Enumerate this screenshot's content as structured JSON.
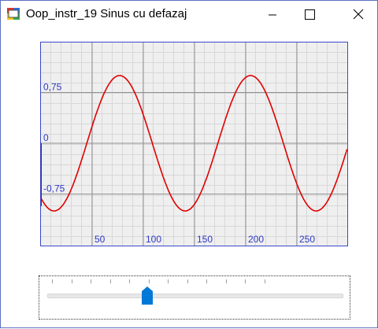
{
  "window": {
    "title": "Oop_instr_19 Sinus cu defazaj",
    "icons": {
      "app": "form-app-icon",
      "minimize": "minimize-icon",
      "maximize": "maximize-icon",
      "close": "close-icon"
    }
  },
  "colors": {
    "plot_bg": "#efefef",
    "plot_border": "#3a48c8",
    "grid_minor": "#d8d8d8",
    "grid_major": "#909090",
    "curve": "#e00000",
    "label": "#2e38c8",
    "slider_thumb": "#0078d7"
  },
  "plot": {
    "y_labels": [
      "0,75",
      "0",
      "-0,75"
    ],
    "x_labels": [
      "50",
      "100",
      "150",
      "200",
      "250"
    ],
    "x_range": [
      0,
      290
    ],
    "y_range": [
      -1.05,
      1.05
    ],
    "curve": {
      "amplitude": 1,
      "period": 128,
      "phase_deg": 234
    }
  },
  "slider": {
    "tick_count": 12,
    "value_index": 5
  }
}
